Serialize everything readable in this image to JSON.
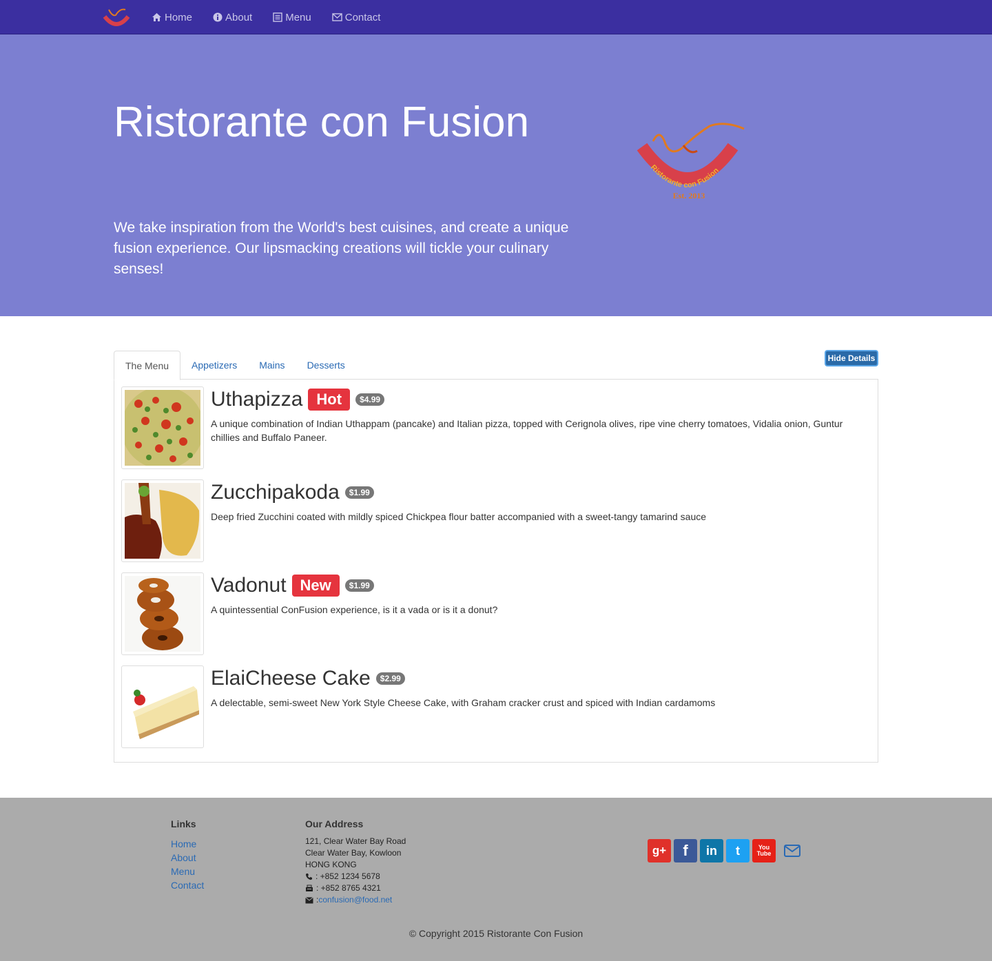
{
  "nav": {
    "logo_icon": "restaurant-logo",
    "items": [
      {
        "label": "Home",
        "icon": "home-icon"
      },
      {
        "label": "About",
        "icon": "info-icon"
      },
      {
        "label": "Menu",
        "icon": "list-icon"
      },
      {
        "label": "Contact",
        "icon": "envelope-icon"
      }
    ]
  },
  "jumbotron": {
    "title": "Ristorante con Fusion",
    "text": "We take inspiration from the World's best cuisines, and create a unique fusion experience. Our lipsmacking creations will tickle your culinary senses!",
    "logo_ring_text": "Ristorante con Fusion",
    "logo_est_text": "Est. 2013"
  },
  "tabs": [
    {
      "label": "The Menu",
      "active": true
    },
    {
      "label": "Appetizers",
      "active": false
    },
    {
      "label": "Mains",
      "active": false
    },
    {
      "label": "Desserts",
      "active": false
    }
  ],
  "hide_details_label": "Hide Details",
  "dishes": [
    {
      "name": "Uthapizza",
      "label": "Hot",
      "price": "$4.99",
      "description": "A unique combination of Indian Uthappam (pancake) and Italian pizza, topped with Cerignola olives, ripe vine cherry tomatoes, Vidalia onion, Guntur chillies and Buffalo Paneer."
    },
    {
      "name": "Zucchipakoda",
      "label": "",
      "price": "$1.99",
      "description": "Deep fried Zucchini coated with mildly spiced Chickpea flour batter accompanied with a sweet-tangy tamarind sauce"
    },
    {
      "name": "Vadonut",
      "label": "New",
      "price": "$1.99",
      "description": "A quintessential ConFusion experience, is it a vada or is it a donut?"
    },
    {
      "name": "ElaiCheese Cake",
      "label": "",
      "price": "$2.99",
      "description": "A delectable, semi-sweet New York Style Cheese Cake, with Graham cracker crust and spiced with Indian cardamoms"
    }
  ],
  "footer": {
    "links_heading": "Links",
    "links": [
      "Home",
      "About",
      "Menu",
      "Contact"
    ],
    "address_heading": "Our Address",
    "address_lines": [
      "121, Clear Water Bay Road",
      "Clear Water Bay, Kowloon",
      "HONG KONG"
    ],
    "phone": ": +852 1234 5678",
    "fax": ": +852 8765 4321",
    "email_prefix": ": ",
    "email": "confusion@food.net",
    "socials": [
      {
        "icon": "google-plus-icon",
        "glyph": "g+",
        "color": "#e0312a"
      },
      {
        "icon": "facebook-icon",
        "glyph": "f",
        "color": "#3b5998"
      },
      {
        "icon": "linkedin-icon",
        "glyph": "in",
        "color": "#0e76a8"
      },
      {
        "icon": "twitter-icon",
        "glyph": "t",
        "color": "#1da1f2"
      },
      {
        "icon": "youtube-icon",
        "glyph": "You Tube",
        "color": "#e62117"
      }
    ],
    "copyright": "© Copyright 2015 Ristorante Con Fusion"
  },
  "colors": {
    "navbar": "#3b2fa0",
    "jumbotron": "#7c7fd1",
    "label_red": "#e5343e",
    "link": "#2a6ab4",
    "footer": "#ababab"
  }
}
